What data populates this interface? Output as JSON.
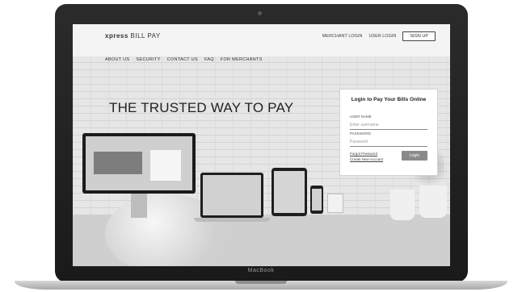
{
  "device": {
    "label": "MacBook"
  },
  "site": {
    "logo": {
      "primary": "xpress",
      "secondary": "BILL PAY"
    },
    "top_links": {
      "merchant_login": "MERCHANT LOGIN",
      "user_login": "USER LOGIN",
      "signup": "SIGN UP"
    },
    "nav": [
      "ABOUT US",
      "SECURITY",
      "CONTACT US",
      "FAQ",
      "FOR MERCHANTS"
    ],
    "headline": "THE TRUSTED WAY TO PAY",
    "login": {
      "title": "Login to Pay Your Bills Online",
      "username_label": "USER NAME",
      "username_placeholder": "Enter username",
      "password_label": "PASSWORD",
      "password_placeholder": "Password",
      "links": [
        "Forgot Password",
        "Create New Account"
      ],
      "button": "Login"
    }
  }
}
